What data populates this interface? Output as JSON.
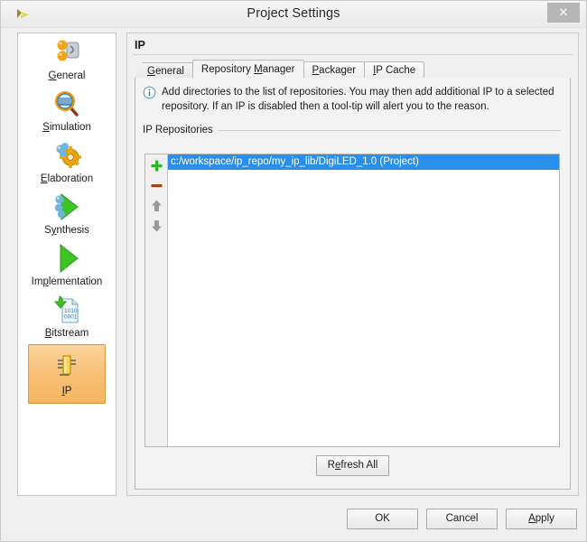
{
  "window": {
    "title": "Project Settings",
    "logo_icon": "vivado-logo-icon",
    "close_label": "✕"
  },
  "sidebar": {
    "items": [
      {
        "label_pre": "",
        "label_mn": "G",
        "label_post": "eneral",
        "name": "general",
        "icon": "general-icon",
        "selected": false
      },
      {
        "label_pre": "",
        "label_mn": "S",
        "label_post": "imulation",
        "name": "simulation",
        "icon": "simulation-icon",
        "selected": false
      },
      {
        "label_pre": "",
        "label_mn": "E",
        "label_post": "laboration",
        "name": "elaboration",
        "icon": "elaboration-icon",
        "selected": false
      },
      {
        "label_pre": "S",
        "label_mn": "y",
        "label_post": "nthesis",
        "name": "synthesis",
        "icon": "synthesis-icon",
        "selected": false
      },
      {
        "label_pre": "Im",
        "label_mn": "p",
        "label_post": "lementation",
        "name": "implementation",
        "icon": "implementation-icon",
        "selected": false
      },
      {
        "label_pre": "",
        "label_mn": "B",
        "label_post": "itstream",
        "name": "bitstream",
        "icon": "bitstream-icon",
        "selected": false
      },
      {
        "label_pre": "",
        "label_mn": "I",
        "label_post": "P",
        "name": "ip",
        "icon": "ip-chip-icon",
        "selected": true
      }
    ]
  },
  "panel": {
    "title": "IP",
    "tabs": [
      {
        "label_pre": "",
        "label_mn": "G",
        "label_post": "eneral",
        "name": "general",
        "active": false,
        "slant": true
      },
      {
        "label_pre": "Repository ",
        "label_mn": "M",
        "label_post": "anager",
        "name": "repository-manager",
        "active": true,
        "slant": false
      },
      {
        "label_pre": "",
        "label_mn": "P",
        "label_post": "ackager",
        "name": "packager",
        "active": false,
        "slant": false
      },
      {
        "label_pre": "",
        "label_mn": "I",
        "label_post": "P Cache",
        "name": "ip-cache",
        "active": false,
        "slant": false
      }
    ],
    "info": {
      "icon": "info-circle-icon",
      "line1": "Add directories to the list of repositories. You may then add additional IP to a selected",
      "line2": "repository. If an IP is disabled then a tool-tip will alert you to the reason."
    },
    "group_label": "IP Repositories",
    "list_toolbar": [
      {
        "name": "add-repository-button",
        "icon": "plus-icon"
      },
      {
        "name": "remove-repository-button",
        "icon": "minus-icon"
      },
      {
        "name": "move-up-button",
        "icon": "arrow-up-icon"
      },
      {
        "name": "move-down-button",
        "icon": "arrow-down-icon"
      }
    ],
    "repositories": [
      {
        "path": "c:/workspace/ip_repo/my_ip_lib/DigiLED_1.0 (Project)",
        "selected": true
      }
    ],
    "refresh": {
      "label_pre": "R",
      "label_mn": "e",
      "label_post": "fresh All"
    }
  },
  "footer": {
    "buttons": [
      {
        "label_pre": "OK",
        "label_mn": "",
        "label_post": "",
        "name": "ok-button"
      },
      {
        "label_pre": "Cancel",
        "label_mn": "",
        "label_post": "",
        "name": "cancel-button"
      },
      {
        "label_pre": "",
        "label_mn": "A",
        "label_post": "pply",
        "name": "apply-button"
      }
    ]
  },
  "colors": {
    "selection_blue": "#2a8fea",
    "sidebar_selected_orange": "#f7c078",
    "window_bg": "#f0f0f0",
    "accent_green": "#27ae38",
    "accent_brown": "#a0441b"
  }
}
